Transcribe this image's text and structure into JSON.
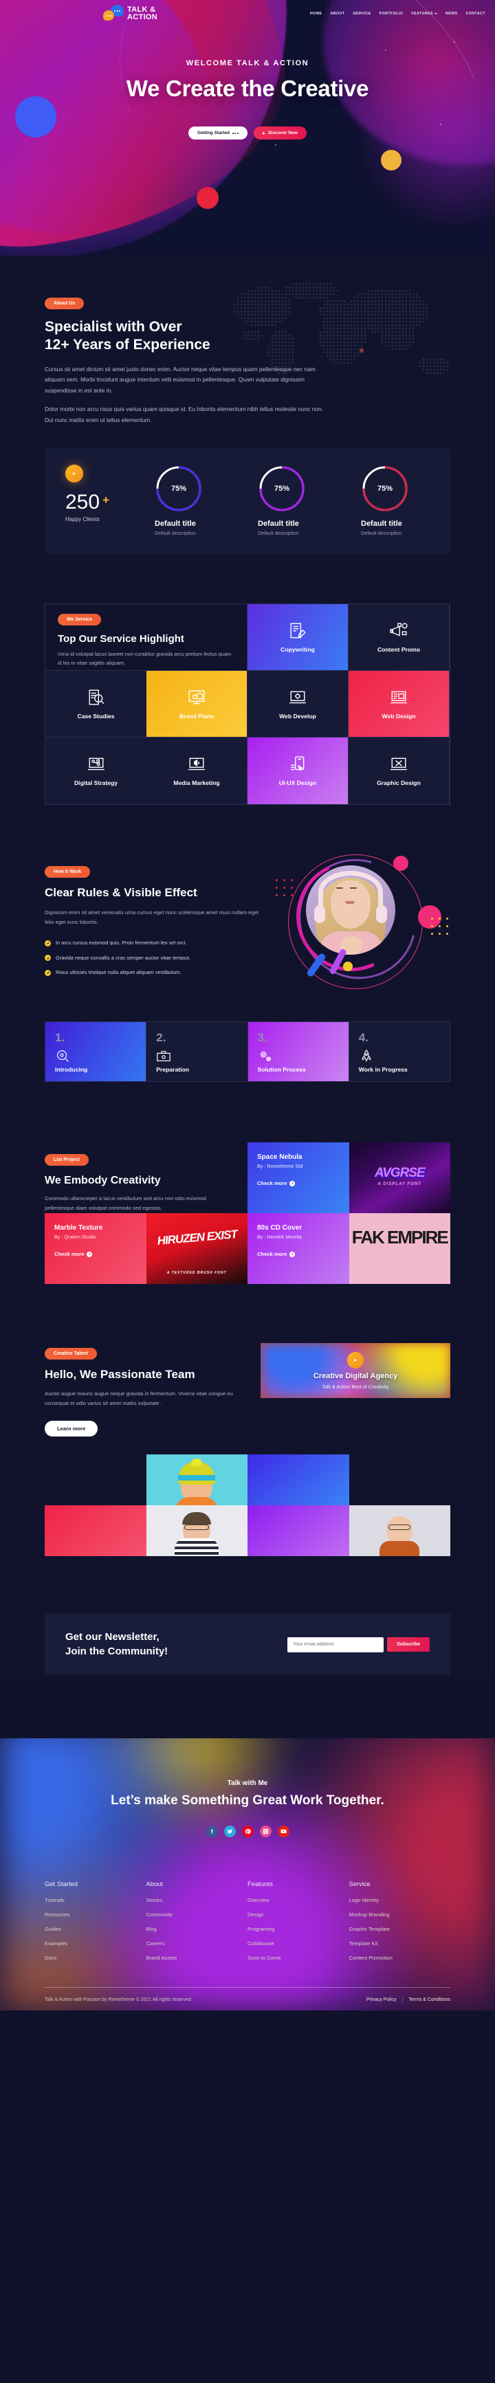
{
  "brand": {
    "line1": "TALK &",
    "line2": "ACTION"
  },
  "nav": {
    "items": [
      {
        "label": "HOME",
        "dropdown": false
      },
      {
        "label": "ABOUT",
        "dropdown": false
      },
      {
        "label": "SERVICE",
        "dropdown": false
      },
      {
        "label": "PORTFOLIO",
        "dropdown": false
      },
      {
        "label": "FEATURES",
        "dropdown": true
      },
      {
        "label": "NEWS",
        "dropdown": false
      },
      {
        "label": "CONTACT",
        "dropdown": false
      }
    ]
  },
  "hero": {
    "welcome": "WELCOME TALK & ACTION",
    "title": "We Create the Creative",
    "btn_primary": "Getting Started",
    "btn_secondary": "Discover Now"
  },
  "about": {
    "badge": "About Us",
    "title_line1": "Specialist with Over",
    "title_line2": "12+ Years of Experience",
    "para1": "Cursus sit amet dictum sit amet justo donec enim. Auctor neque vitae tempus quam pellentesque nec nam aliquam sem. Morbi tincidunt augue interdum velit euismod in pellentesque. Quam vulputate dignissim suspendisse in est ante in.",
    "para2": "Dolor morbi non arcu risus quis varius quam quisque id. Eu lobortis elementum nibh tellus molestie nunc non. Dui nunc mattis enim ut tellus elementum.",
    "stats": {
      "count": "250",
      "plus": "+",
      "label": "Happy Clients",
      "rings": [
        {
          "pct": "75%",
          "value": 75,
          "title": "Default title",
          "desc": "Default description",
          "color": "#4a2ae8"
        },
        {
          "pct": "75%",
          "value": 75,
          "title": "Default title",
          "desc": "Default description",
          "color": "#a81ff0"
        },
        {
          "pct": "75%",
          "value": 75,
          "title": "Default title",
          "desc": "Default description",
          "color": "#d8234f"
        }
      ]
    }
  },
  "services": {
    "badge": "We Service",
    "title": "Top Our Service Highlight",
    "desc": "Urna id volutpat lacus laoreet non curabitur gravida arcu pretium lectus quam id leo in vitae sagittis aliquam.",
    "items": [
      {
        "label": "Copywriting",
        "icon": "copywriting-icon",
        "bg": "blue"
      },
      {
        "label": "Content Promo",
        "icon": "megaphone-icon",
        "bg": "dark"
      },
      {
        "label": "Case Studies",
        "icon": "document-search-icon",
        "bg": "dark"
      },
      {
        "label": "Brand Plans",
        "icon": "lightbulb-chart-icon",
        "bg": "yellow"
      },
      {
        "label": "Web Develop",
        "icon": "laptop-gear-icon",
        "bg": "dark"
      },
      {
        "label": "Web Design",
        "icon": "laptop-layout-icon",
        "bg": "red"
      },
      {
        "label": "Digital Strategy",
        "icon": "laptop-strategy-icon",
        "bg": "dark"
      },
      {
        "label": "Media Marketing",
        "icon": "laptop-speaker-icon",
        "bg": "dark"
      },
      {
        "label": "UI-UX Design",
        "icon": "mobile-ux-icon",
        "bg": "purple"
      },
      {
        "label": "Graphic Design",
        "icon": "laptop-tools-icon",
        "bg": "dark"
      }
    ]
  },
  "work": {
    "badge": "How It Work",
    "title": "Clear Rules & Visible Effect",
    "lead": "Dignissim enim sit amet venenatis urna cursus eget nunc scelerisque amet risus nullam eget felis eget nunc lobortis.",
    "checks": [
      "In arcu cursus euismod quis. Proin fermentum leo vel orci.",
      "Gravida neque convallis a cras semper auctor vitae tempus.",
      "Risus ultricies tristique nulla aliquet aliquam vestibulum."
    ],
    "steps": [
      {
        "num": "1.",
        "title": "Introducing",
        "icon": "magnifier-eye-icon",
        "bg": "blue"
      },
      {
        "num": "2.",
        "title": "Preparation",
        "icon": "briefcase-gear-icon",
        "bg": "dark"
      },
      {
        "num": "3.",
        "title": "Solution Process",
        "icon": "gears-icon",
        "bg": "purple"
      },
      {
        "num": "4.",
        "title": "Work in Progress",
        "icon": "rocket-icon",
        "bg": "dark"
      }
    ]
  },
  "projects": {
    "badge": "List Project",
    "title": "We Embody Creativity",
    "desc": "Commodo ullamcorper a lacus vestibulum sed arcu non odio euismod pellentesque diam volutpat commodo sed egestas.",
    "more_label": "Check more",
    "items": [
      {
        "title": "Space Nebula",
        "by": "By : Rometheme Std",
        "thumb_text": "AVGRSE",
        "thumb_sub": "A DISPLAY FONT",
        "bg": "blue"
      },
      {
        "title": "Marble Texture",
        "by": "By : Qraken Studio",
        "thumb_text": "HIRUZEN EXIST",
        "thumb_sub": "A TEXTURED BRUSH FONT",
        "bg": "red"
      },
      {
        "title": "80s CD Cover",
        "by": "By : Hendrik Morella",
        "thumb_text": "FAK EMPIRE",
        "thumb_sub": "",
        "bg": "purple"
      }
    ]
  },
  "team": {
    "badge": "Creative Talent",
    "title": "Hello, We Passionate Team",
    "desc": "Auctor augue mauris augue neque gravida in fermentum. Viverra vitae congue eu consequat  et odio varius sit amet mattis vulputate .",
    "button": "Learn more",
    "video_title": "Creative Digital Agency",
    "video_sub": "Talk & Action Best of Creativity"
  },
  "newsletter": {
    "title_line1": "Get our Newsletter,",
    "title_line2": "Join the Community!",
    "placeholder": "Your email address",
    "button": "Subscribe"
  },
  "footer": {
    "kicker": "Talk with Me",
    "headline": "Let’s make Something Great Work Together.",
    "socials": [
      {
        "name": "facebook-icon",
        "color": "#3b5998"
      },
      {
        "name": "twitter-icon",
        "color": "#2caae1"
      },
      {
        "name": "pinterest-icon",
        "color": "#e60023"
      },
      {
        "name": "instagram-icon",
        "color": "#e4508f"
      },
      {
        "name": "youtube-icon",
        "color": "#e62117"
      }
    ],
    "columns": [
      {
        "heading": "Get Started",
        "links": [
          "Tutorials",
          "Resources",
          "Guides",
          "Examples",
          "Docs"
        ]
      },
      {
        "heading": "About",
        "links": [
          "Stories",
          "Community",
          "Blog",
          "Careers",
          "Brand Assets"
        ]
      },
      {
        "heading": "Features",
        "links": [
          "Overview",
          "Design",
          "Programing",
          "Collaborate",
          "Soon to Come"
        ]
      },
      {
        "heading": "Service",
        "links": [
          "Logo Identity",
          "Mockup Branding",
          "Graphic Template",
          "Template Kit",
          "Content Promotion"
        ]
      }
    ],
    "copyright": "Talk & Action with Passion by Rometheme © 2021 All rights reserved",
    "privacy": "Privacy Policy",
    "terms": "Terms & Conditions"
  }
}
